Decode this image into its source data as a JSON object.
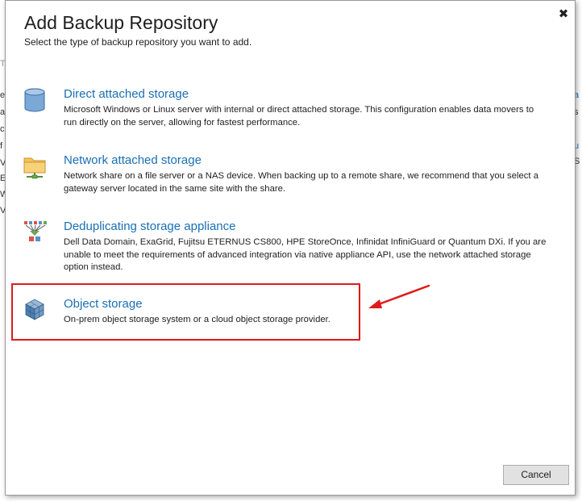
{
  "dialog": {
    "title": "Add Backup Repository",
    "subtitle": "Select the type of backup repository you want to add.",
    "close_label": "✖",
    "cancel_label": "Cancel"
  },
  "options": [
    {
      "title": "Direct attached storage",
      "description": "Microsoft Windows or Linux server with internal or direct attached storage. This configuration enables data movers to run directly on the server, allowing for fastest performance.",
      "icon": "database-icon"
    },
    {
      "title": "Network attached storage",
      "description": "Network share on a file server or a NAS device. When backing up to a remote share, we recommend that you select a gateway server located in the same site with the share.",
      "icon": "network-folder-icon"
    },
    {
      "title": "Deduplicating storage appliance",
      "description": "Dell Data Domain, ExaGrid, Fujitsu ETERNUS CS800, HPE StoreOnce, Infinidat InfiniGuard or Quantum DXi. If you are unable to meet the requirements of advanced integration via native appliance API, use the network attached storage option instead.",
      "icon": "deduplication-icon"
    },
    {
      "title": "Object storage",
      "description": "On-prem object storage system or a cloud object storage provider.",
      "icon": "object-storage-cube-icon"
    }
  ],
  "background": {
    "left_fragments": [
      "e",
      "a",
      "c",
      "f",
      "V",
      "E",
      "W",
      "Va"
    ],
    "right_fragments": [
      "a",
      "s",
      "u",
      "S"
    ]
  },
  "colors": {
    "link_blue": "#1a6fb5",
    "highlight_red": "#e01a1a"
  }
}
